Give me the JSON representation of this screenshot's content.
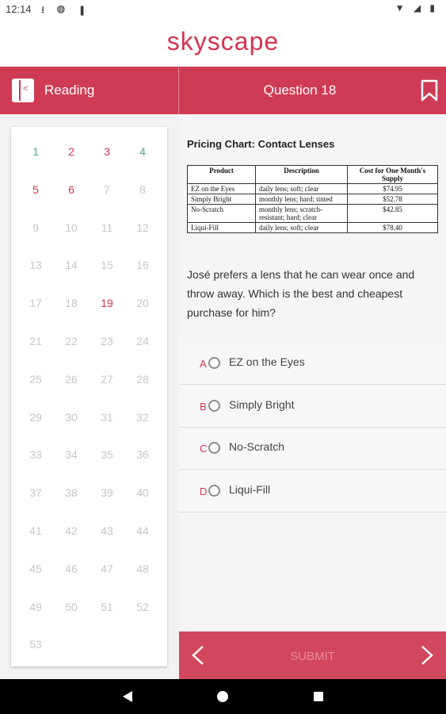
{
  "status": {
    "time": "12:14",
    "left_icons": "⭳ ◍ ▮",
    "right_icons": "▼ ◢ ▮"
  },
  "logo": "skyscape",
  "header": {
    "section": "Reading",
    "question": "Question 18"
  },
  "grid": {
    "numbers": [
      "1",
      "2",
      "3",
      "4",
      "5",
      "6",
      "7",
      "8",
      "9",
      "10",
      "11",
      "12",
      "13",
      "14",
      "15",
      "16",
      "17",
      "18",
      "19",
      "20",
      "21",
      "22",
      "23",
      "24",
      "25",
      "26",
      "27",
      "28",
      "29",
      "30",
      "31",
      "32",
      "33",
      "34",
      "35",
      "36",
      "37",
      "38",
      "39",
      "40",
      "41",
      "42",
      "43",
      "44",
      "45",
      "46",
      "47",
      "48",
      "49",
      "50",
      "51",
      "52",
      "53"
    ],
    "answered": [
      "1",
      "4"
    ],
    "visited": [
      "2",
      "3",
      "5",
      "6",
      "19"
    ]
  },
  "chart_title": "Pricing Chart: Contact Lenses",
  "table": {
    "headers": [
      "Product",
      "Description",
      "Cost for One Month's Supply"
    ],
    "rows": [
      [
        "EZ on the Eyes",
        "daily lens; soft; clear",
        "$74.95"
      ],
      [
        "Simply Bright",
        "monthly lens; hard; tinted",
        "$52.78"
      ],
      [
        "No-Scratch",
        "monthly lens; scratch-resistant; hard; clear",
        "$42.85"
      ],
      [
        "Liqui-Fill",
        "daily lens; soft; clear",
        "$78.40"
      ]
    ]
  },
  "prompt": "José prefers a lens that he can wear once and throw away. Which is the best and cheapest purchase for him?",
  "choices": [
    {
      "letter": "A",
      "text": "EZ on the Eyes"
    },
    {
      "letter": "B",
      "text": "Simply Bright"
    },
    {
      "letter": "C",
      "text": "No-Scratch"
    },
    {
      "letter": "D",
      "text": "Liqui-Fill"
    }
  ],
  "footer": {
    "submit": "SUBMIT"
  },
  "colors": {
    "accent": "#cf3b55",
    "answered": "#4caf7d",
    "visited": "#d4344f",
    "unvisited": "#c6c6c6"
  },
  "icons": [
    "book-icon",
    "bookmark-icon",
    "radio-icon",
    "chevron-left-icon",
    "chevron-right-icon",
    "nav-back-icon",
    "nav-home-icon",
    "nav-recent-icon"
  ]
}
